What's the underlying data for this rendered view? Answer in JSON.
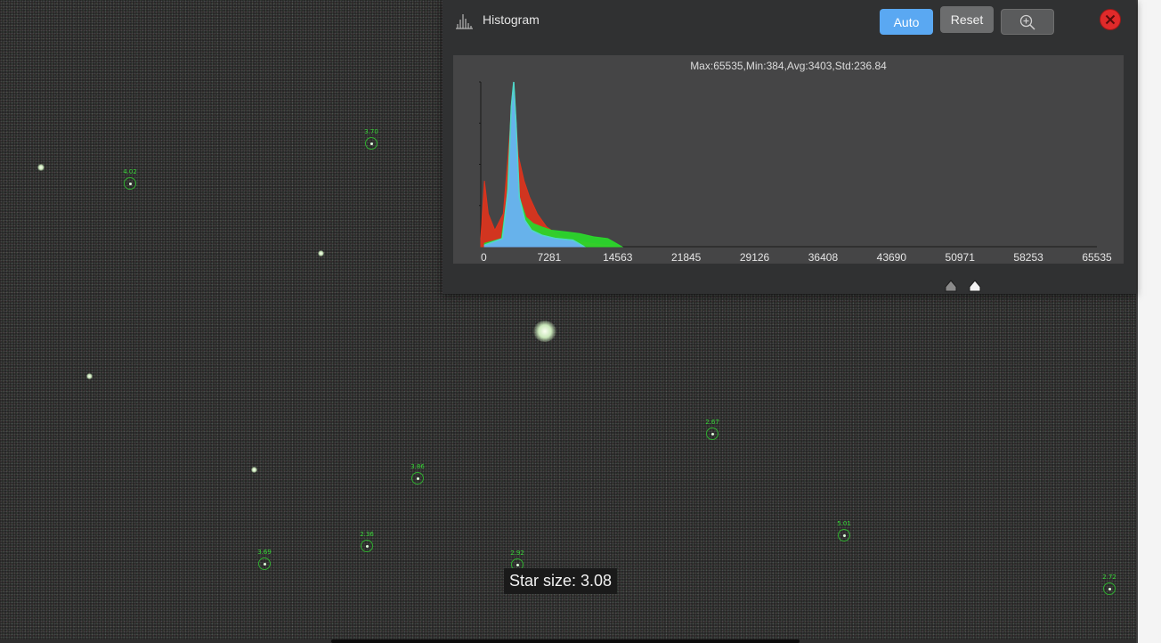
{
  "histogram": {
    "title": "Histogram",
    "auto_label": "Auto",
    "reset_label": "Reset",
    "zoom_icon": "zoom-in-icon",
    "close_icon": "close-icon",
    "stats": "Max:65535,Min:384,Avg:3403,Std:236.84",
    "colors": {
      "red": "#e0331c",
      "green": "#2bd62b",
      "blue": "#6ab0f5",
      "cyan": "#4fd6c8",
      "accent": "#5aa8f2",
      "close": "#e02a2a"
    }
  },
  "chart_data": {
    "type": "area",
    "title": "Max:65535,Min:384,Avg:3403,Std:236.84",
    "xlabel": "",
    "ylabel": "",
    "xlim": [
      0,
      65535
    ],
    "x_ticks": [
      "0",
      "7281",
      "14563",
      "21845",
      "29126",
      "36408",
      "43690",
      "50971",
      "58253",
      "65535"
    ],
    "series": [
      {
        "color": "red",
        "points": [
          [
            0,
            0.05
          ],
          [
            384,
            0.4
          ],
          [
            800,
            0.2
          ],
          [
            1500,
            0.1
          ],
          [
            2400,
            0.2
          ],
          [
            2900,
            0.55
          ],
          [
            3300,
            0.85
          ],
          [
            3500,
            0.95
          ],
          [
            3700,
            0.8
          ],
          [
            4000,
            0.55
          ],
          [
            4600,
            0.4
          ],
          [
            5200,
            0.3
          ],
          [
            6000,
            0.2
          ],
          [
            7000,
            0.12
          ],
          [
            8500,
            0.06
          ],
          [
            10500,
            0.03
          ],
          [
            13000,
            0.01
          ],
          [
            15000,
            0.0
          ]
        ]
      },
      {
        "color": "green",
        "points": [
          [
            384,
            0.02
          ],
          [
            2200,
            0.05
          ],
          [
            2800,
            0.3
          ],
          [
            3200,
            0.8
          ],
          [
            3500,
            0.98
          ],
          [
            3750,
            0.7
          ],
          [
            4100,
            0.3
          ],
          [
            4800,
            0.18
          ],
          [
            5600,
            0.14
          ],
          [
            6500,
            0.12
          ],
          [
            7500,
            0.1
          ],
          [
            9000,
            0.09
          ],
          [
            10500,
            0.08
          ],
          [
            12000,
            0.06
          ],
          [
            13500,
            0.05
          ],
          [
            14100,
            0.03
          ],
          [
            15000,
            0.0
          ]
        ]
      },
      {
        "color": "blue",
        "points": [
          [
            384,
            0.01
          ],
          [
            2300,
            0.05
          ],
          [
            2900,
            0.35
          ],
          [
            3250,
            0.85
          ],
          [
            3500,
            1.0
          ],
          [
            3750,
            0.75
          ],
          [
            4100,
            0.3
          ],
          [
            4700,
            0.16
          ],
          [
            5400,
            0.1
          ],
          [
            6500,
            0.07
          ],
          [
            8000,
            0.05
          ],
          [
            9800,
            0.04
          ],
          [
            11000,
            0.0
          ]
        ]
      }
    ],
    "grid": false,
    "legend": "none"
  },
  "tooltip": {
    "text": "Star size: 3.08"
  },
  "stars": [
    {
      "label": "3.70"
    },
    {
      "label": "4.02"
    },
    {
      "label": "2.67"
    },
    {
      "label": "3.86"
    },
    {
      "label": "2.36"
    },
    {
      "label": "3.69"
    },
    {
      "label": "2.92"
    },
    {
      "label": "5.01"
    },
    {
      "label": "2.72"
    }
  ]
}
